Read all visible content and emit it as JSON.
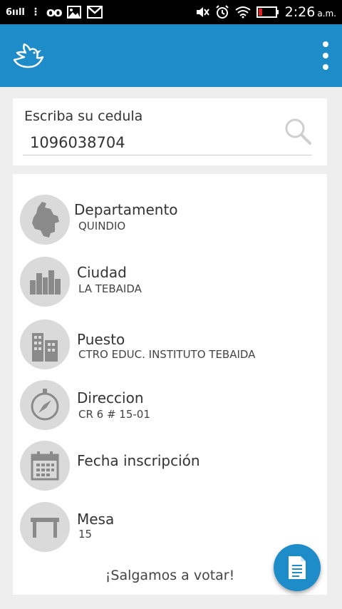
{
  "status_bar": {
    "signal_text": "6ııll",
    "voicemail_glyph": "ᴏᴏ",
    "time": "2:26",
    "ampm": "a.m.",
    "icons": [
      "signal-icon",
      "voicemail-icon",
      "gallery-icon",
      "gmail-icon",
      "mute-icon",
      "alarm-icon",
      "wifi-icon",
      "battery-icon"
    ]
  },
  "app_bar": {
    "color": "#1e8cc8",
    "logo_icon": "dove-icon",
    "menu_icon": "overflow-menu-icon"
  },
  "search": {
    "label": "Escriba su cedula",
    "value": "1096038704"
  },
  "results": [
    {
      "title": "Departamento",
      "value": "QUINDIO",
      "icon": "colombia-map-icon"
    },
    {
      "title": "Ciudad",
      "value": "LA TEBAIDA",
      "icon": "city-icon"
    },
    {
      "title": "Puesto",
      "value": "CTRO EDUC. INSTITUTO TEBAIDA",
      "icon": "building-icon"
    },
    {
      "title": "Direccion",
      "value": "CR 6 # 15-01",
      "icon": "compass-icon"
    },
    {
      "title": "Fecha inscripción",
      "value": "",
      "icon": "calendar-icon"
    },
    {
      "title": "Mesa",
      "value": "15",
      "icon": "table-icon"
    }
  ],
  "footer_text": "¡Salgamos a votar!",
  "fab_icon": "document-icon"
}
